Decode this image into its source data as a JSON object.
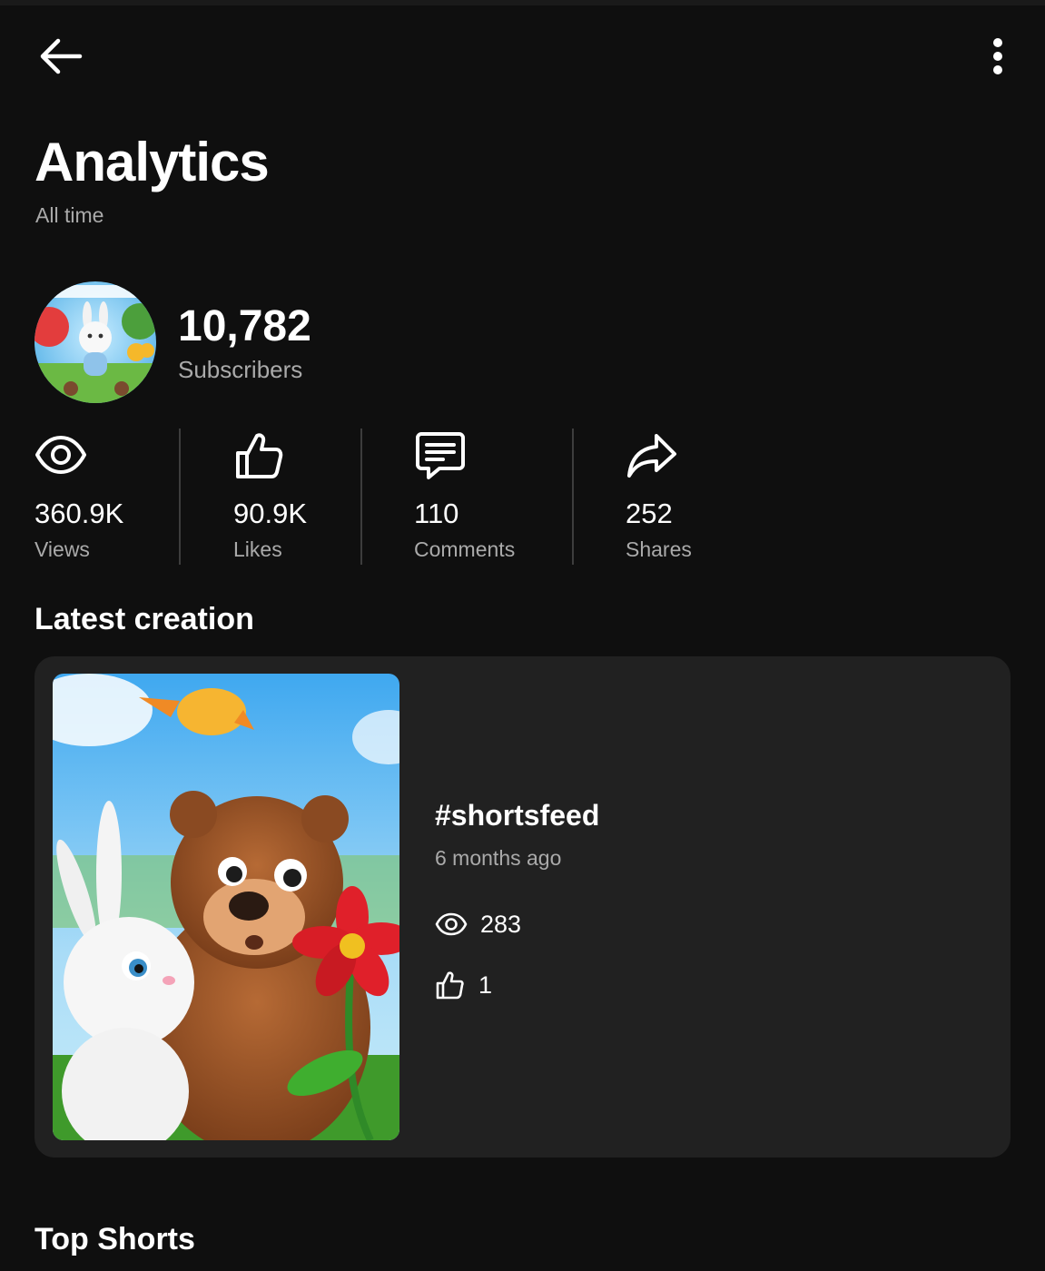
{
  "header": {
    "back_icon": "arrow-left-icon",
    "more_icon": "more-vertical-icon",
    "title": "Analytics",
    "subtitle": "All time"
  },
  "channel": {
    "subscriber_count": "10,782",
    "subscriber_label": "Subscribers"
  },
  "stats": [
    {
      "icon": "eye-icon",
      "value": "360.9K",
      "label": "Views"
    },
    {
      "icon": "thumbs-up-icon",
      "value": "90.9K",
      "label": "Likes"
    },
    {
      "icon": "comment-icon",
      "value": "110",
      "label": "Comments"
    },
    {
      "icon": "share-icon",
      "value": "252",
      "label": "Shares"
    }
  ],
  "latest": {
    "section_title": "Latest creation",
    "video": {
      "title": "#shortsfeed",
      "age": "6 months ago",
      "views": "283",
      "likes": "1"
    }
  },
  "top_shorts": {
    "section_title": "Top Shorts"
  },
  "colors": {
    "background": "#0f0f0f",
    "card": "#212121",
    "text": "#ffffff",
    "secondary_text": "#aaaaaa",
    "divider": "#3d3d3d"
  }
}
